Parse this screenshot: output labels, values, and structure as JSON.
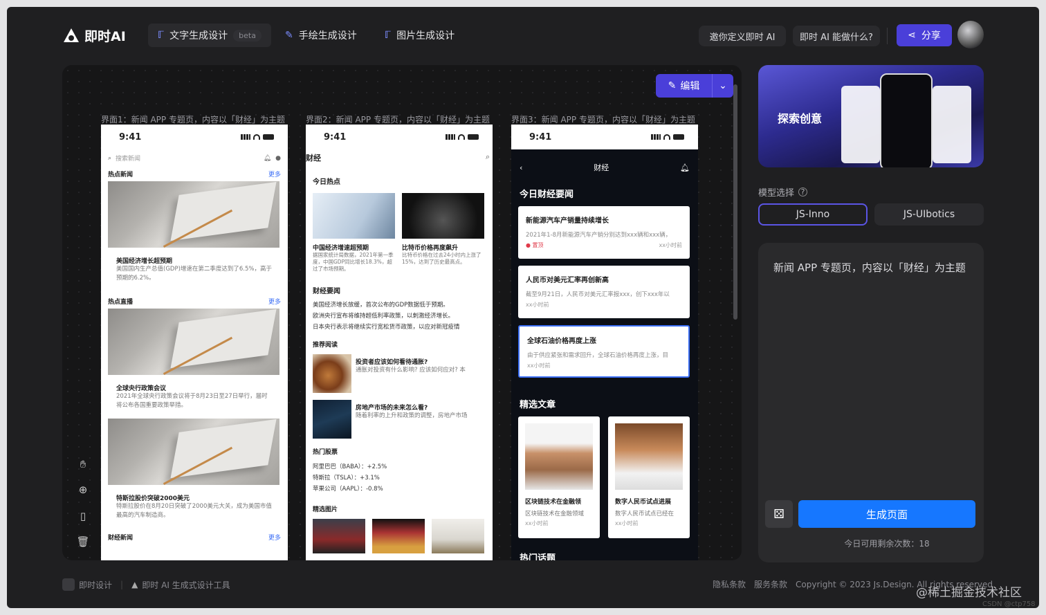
{
  "app": {
    "name": "即时AI"
  },
  "tabs": [
    {
      "label": "文字生成设计",
      "badge": "beta"
    },
    {
      "label": "手绘生成设计"
    },
    {
      "label": "图片生成设计"
    }
  ],
  "header": {
    "invite": "邀你定义即时 AI",
    "what": "即时 AI 能做什么?",
    "share": "分享"
  },
  "canvas": {
    "edit_label": "编辑",
    "frames": [
      "界面1：新闻 APP 专题页，内容以「财经」为主题",
      "界面2：新闻 APP 专题页，内容以「财经」为主题",
      "界面3：新闻 APP 专题页，内容以「财经」为主题"
    ]
  },
  "phone1": {
    "time": "9:41",
    "search_placeholder": "搜索新闻",
    "sections": [
      {
        "title": "热点新闻",
        "more": "更多"
      },
      {
        "title": "热点直播",
        "more": "更多"
      },
      {
        "title": "财经新闻",
        "more": "更多"
      }
    ],
    "items": [
      {
        "title": "美国经济增长超预期",
        "desc": "美国国内生产总值(GDP)增速在第二季度达到了6.5%，高于预期的6.2%。"
      },
      {
        "title": "全球央行政策会议",
        "desc": "2021年全球央行政策会议将于8月23日至27日举行，届时将公布各国重要政策举措。"
      },
      {
        "title": "特斯拉股价突破2000美元",
        "desc": "特斯拉股价在8月20日突破了2000美元大关，成为美国市值最高的汽车制造商。"
      }
    ]
  },
  "phone2": {
    "time": "9:41",
    "title": "财经",
    "hot_title": "今日热点",
    "hot": [
      {
        "title": "中国经济增速超预期",
        "desc": "据国家统计局数据，2021年第一季度，中国GDP同比增长18.3%，超过了市场预期。"
      },
      {
        "title": "比特币价格再度飙升",
        "desc": "比特币价格在过去24小时内上涨了15%，达到了历史最高点。"
      }
    ],
    "news_title": "财经要闻",
    "news": [
      "美国经济增长放缓，首次公布的GDP数据低于预期。",
      "欧洲央行宣布将维持超低利率政策，以刺激经济增长。",
      "日本央行表示将继续实行宽松货币政策，以应对新冠疫情"
    ],
    "reco_title": "推荐阅读",
    "reco": [
      {
        "title": "投资者应该如何看待通胀?",
        "desc": "通胀对投资有什么影响? 应该如何应对? 本"
      },
      {
        "title": "房地产市场的未来怎么看?",
        "desc": "随着利率的上升和政策的调整，房地产市场"
      }
    ],
    "stocks_title": "热门股票",
    "stocks": [
      "阿里巴巴（BABA）：+2.5%",
      "特斯拉（TSLA）：+3.1%",
      "苹果公司（AAPL）：-0.8%"
    ],
    "pics_title": "精选图片"
  },
  "phone3": {
    "time": "9:41",
    "title": "财经",
    "today_title": "今日财经要闻",
    "cards": [
      {
        "title": "新能源汽车产销量持续增长",
        "desc": "2021年1-8月新能源汽车产销分别达到xxx辆和xxx辆，",
        "tag": "置顶",
        "time": "xx小时前"
      },
      {
        "title": "人民币对美元汇率再创新高",
        "desc": "截至9月21日，人民币对美元汇率报xxx，创下xxx年以",
        "time": "xx小时前"
      },
      {
        "title": "全球石油价格再度上涨",
        "desc": "由于供应紧张和需求回升，全球石油价格再度上涨，目",
        "time": "xx小时前"
      }
    ],
    "articles_title": "精选文章",
    "articles": [
      {
        "title": "区块链技术在金融领",
        "desc": "区块链技术在金融领域",
        "time": "xx小时前"
      },
      {
        "title": "数字人民币试点进展",
        "desc": "数字人民币试点已经在",
        "time": "xx小时前"
      }
    ],
    "topics_title": "热门话题"
  },
  "right": {
    "banner_text": "探索创意",
    "model_label": "模型选择",
    "models": [
      "JS-Inno",
      "JS-UIbotics"
    ],
    "prompt": "新闻 APP 专题页，内容以「财经」为主题",
    "generate": "生成页面",
    "quota": "今日可用剩余次数：18"
  },
  "footer": {
    "brand1": "即时设计",
    "brand2": "即时 AI 生成式设计工具",
    "privacy": "隐私条款",
    "terms": "服务条款",
    "copyright": "Copyright © 2023 Js.Design. All rights reserved"
  },
  "watermark": {
    "line1": "@稀土掘金技术社区",
    "line2": "CSDN @ctp758"
  },
  "colors": {
    "accent": "#4a3fd9",
    "primary": "#1677ff",
    "bg": "#1f1f21"
  }
}
